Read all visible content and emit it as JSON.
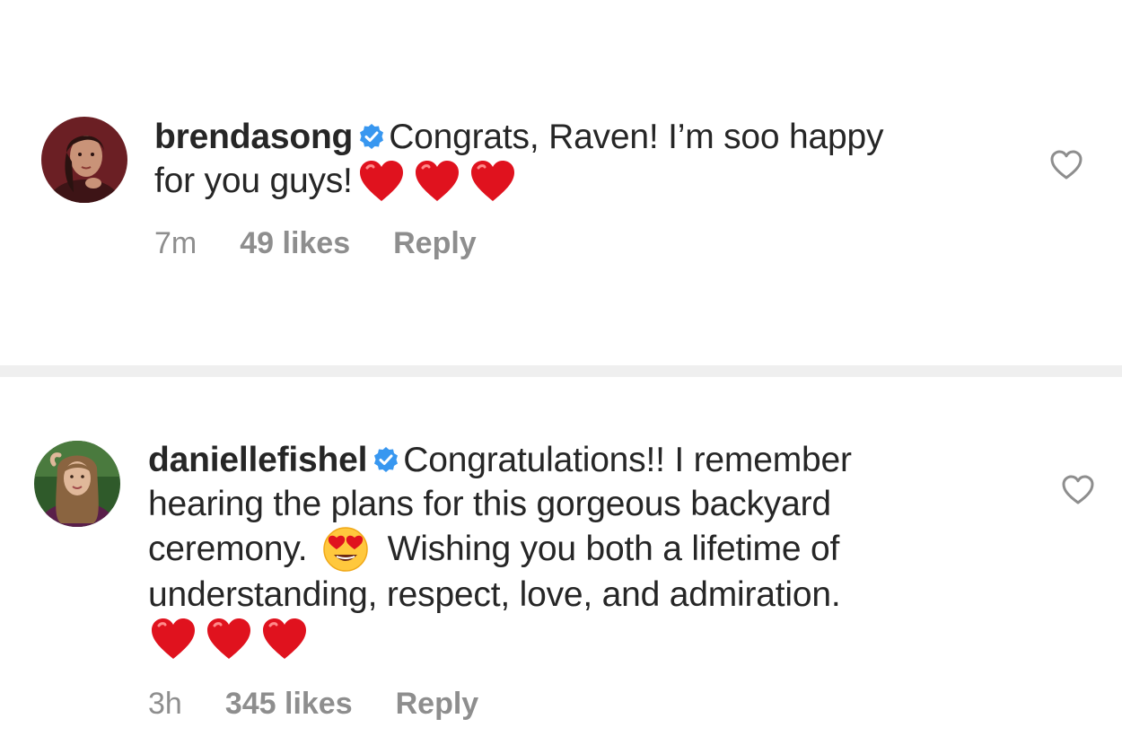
{
  "comments": [
    {
      "username": "brendasong",
      "verified": true,
      "text_line1": "Congrats, Raven! I’m soo happy",
      "text_line2": "for you guys!",
      "time": "7m",
      "likes": "49 likes",
      "reply": "Reply"
    },
    {
      "username": "daniellefishel",
      "verified": true,
      "text_line1": "Congratulations!! I remember",
      "text_line2": "hearing the plans for this gorgeous backyard",
      "text_line3a": "ceremony.",
      "text_line3b": "Wishing you both a lifetime of",
      "text_line4": "understanding, respect, love, and admiration.",
      "time": "3h",
      "likes": "345 likes",
      "reply": "Reply"
    }
  ],
  "colors": {
    "verified_blue": "#3897f0",
    "heart_red": "#e0121e",
    "meta_gray": "#8e8e8e",
    "divider_gray": "#efefef"
  }
}
